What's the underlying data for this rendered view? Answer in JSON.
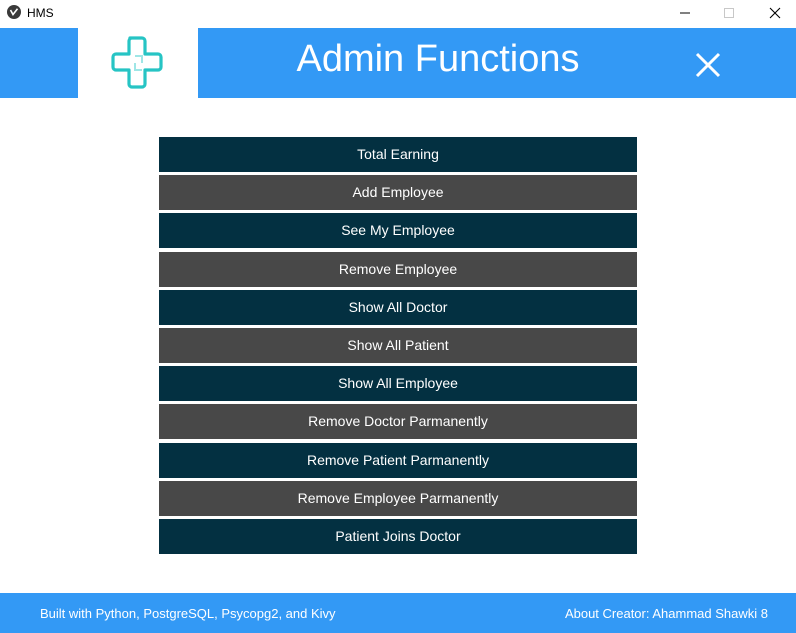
{
  "window": {
    "title": "HMS"
  },
  "header": {
    "title": "Admin Functions",
    "logo_icon": "medical-cross-icon",
    "close_icon": "close-icon"
  },
  "menu": {
    "buttons": [
      {
        "label": "Total Earning",
        "style": "dark"
      },
      {
        "label": "Add Employee",
        "style": "gray"
      },
      {
        "label": "See My Employee",
        "style": "dark"
      },
      {
        "label": "Remove Employee",
        "style": "gray"
      },
      {
        "label": "Show All Doctor",
        "style": "dark"
      },
      {
        "label": "Show All Patient",
        "style": "gray"
      },
      {
        "label": "Show All Employee",
        "style": "dark"
      },
      {
        "label": "Remove Doctor Parmanently",
        "style": "gray"
      },
      {
        "label": "Remove Patient Parmanently",
        "style": "dark"
      },
      {
        "label": "Remove Employee Parmanently",
        "style": "gray"
      },
      {
        "label": "Patient Joins Doctor",
        "style": "dark"
      }
    ]
  },
  "footer": {
    "left_text": "Built with Python, PostgreSQL, Psycopg2, and Kivy",
    "right_text": "About Creator: Ahammad Shawki 8"
  },
  "colors": {
    "header_blue": "#3399f5",
    "button_dark": "#033041",
    "button_gray": "#484848",
    "logo_teal": "#26c4c4"
  }
}
